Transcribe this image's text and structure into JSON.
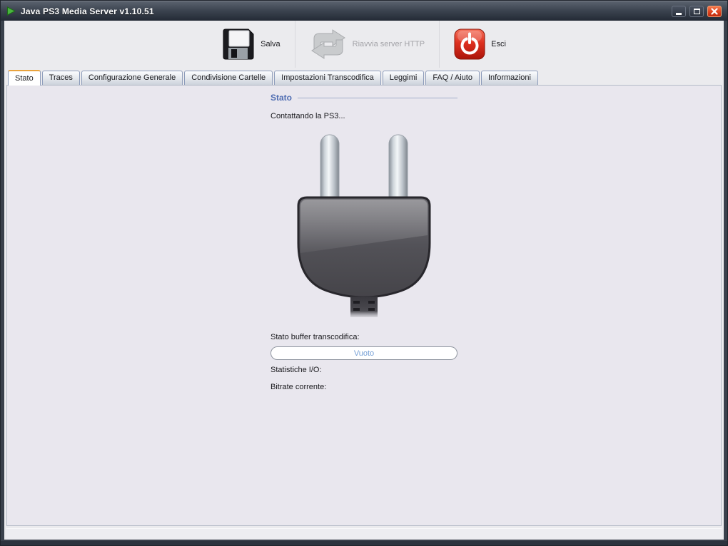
{
  "window": {
    "title": "Java PS3 Media Server v1.10.51",
    "controls": {
      "minimize": "minimize",
      "maximize": "maximize",
      "close": "close"
    }
  },
  "toolbar": {
    "save_label": "Salva",
    "restart_label": "Riavvia server HTTP",
    "restart_enabled": false,
    "exit_label": "Esci"
  },
  "tabs": [
    {
      "label": "Stato",
      "active": true
    },
    {
      "label": "Traces",
      "active": false
    },
    {
      "label": "Configurazione Generale",
      "active": false
    },
    {
      "label": "Condivisione Cartelle",
      "active": false
    },
    {
      "label": "Impostazioni Transcodifica",
      "active": false
    },
    {
      "label": "Leggimi",
      "active": false
    },
    {
      "label": "FAQ / Aiuto",
      "active": false
    },
    {
      "label": "Informazioni",
      "active": false
    }
  ],
  "status_tab": {
    "section_title": "Stato",
    "connecting_text": "Contattando la PS3...",
    "buffer_label": "Stato buffer transcodifica:",
    "buffer_value": "Vuoto",
    "io_label": "Statistiche I/O:",
    "bitrate_label": "Bitrate corrente:"
  },
  "icons": {
    "titlebar": "play-icon",
    "save": "floppy-disk-icon",
    "restart": "refresh-arrows-icon",
    "exit": "power-icon",
    "status_image": "power-plug-image"
  },
  "colors": {
    "titlebar_dark": "#2c3340",
    "active_tab_accent": "#e9a33d",
    "heading_blue": "#4f6db2",
    "buffer_value_blue": "#76a0d6",
    "exit_button_red": "#d8321c",
    "panel_background": "#e9e7ee"
  }
}
